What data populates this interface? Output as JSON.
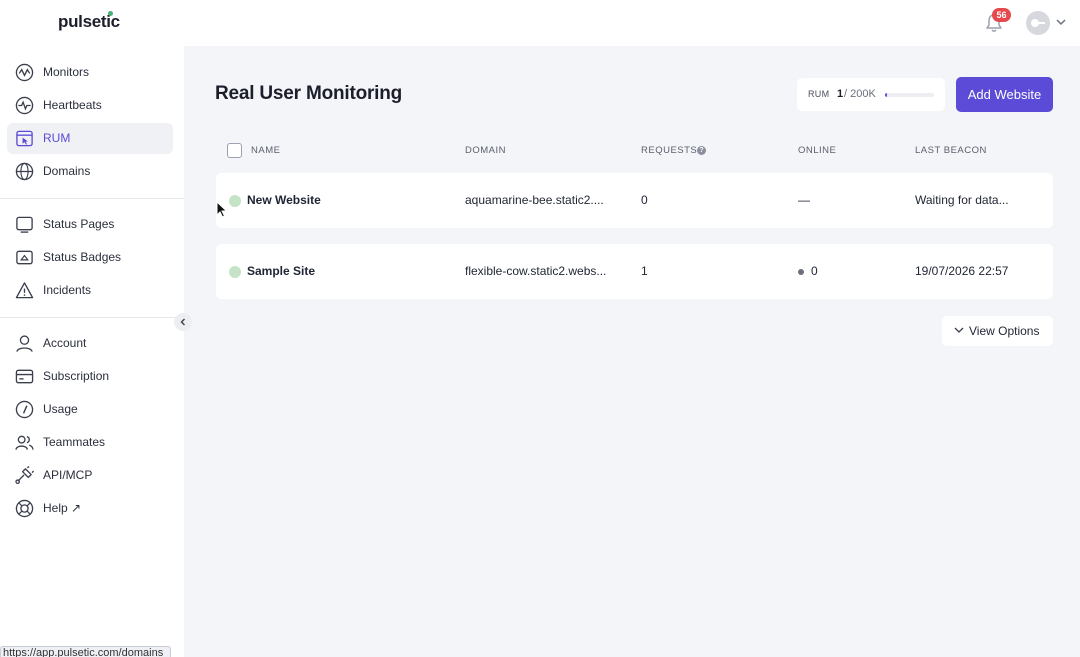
{
  "app": {
    "logo": "pulsetic"
  },
  "header": {
    "notifications_count": "56"
  },
  "sidebar": {
    "items": [
      {
        "label": "Monitors",
        "icon": "pulse-icon"
      },
      {
        "label": "Heartbeats",
        "icon": "heartbeat-icon"
      },
      {
        "label": "RUM",
        "icon": "rum-icon",
        "active": true
      },
      {
        "label": "Domains",
        "icon": "globe-icon"
      },
      {
        "label": "Status Pages",
        "icon": "monitor-icon"
      },
      {
        "label": "Status Badges",
        "icon": "badge-icon"
      },
      {
        "label": "Incidents",
        "icon": "warning-icon"
      },
      {
        "label": "Account",
        "icon": "user-icon"
      },
      {
        "label": "Subscription",
        "icon": "card-icon"
      },
      {
        "label": "Usage",
        "icon": "gauge-icon"
      },
      {
        "label": "Teammates",
        "icon": "team-icon"
      },
      {
        "label": "API/MCP",
        "icon": "plug-icon"
      },
      {
        "label": "Help ↗",
        "icon": "lifebuoy-icon"
      }
    ]
  },
  "statusbar": {
    "url": "https://app.pulsetic.com/domains"
  },
  "main": {
    "title": "Real User Monitoring",
    "usage": {
      "label": "RUM",
      "count": "1",
      "limit": "/ 200K",
      "fraction": 0.02
    },
    "add_button": "Add Website",
    "columns": {
      "name": "NAME",
      "domain": "DOMAIN",
      "requests": "REQUESTS",
      "online": "ONLINE",
      "last_beacon": "LAST BEACON"
    },
    "rows": [
      {
        "name": "New Website",
        "domain": "aquamarine-bee.static2....",
        "requests": "0",
        "online": "—",
        "last_beacon": "Waiting for data..."
      },
      {
        "name": "Sample Site",
        "domain": "flexible-cow.static2.webs...",
        "requests": "1",
        "online": "0",
        "last_beacon": "19/07/2026 22:57"
      }
    ],
    "view_options": "View Options"
  },
  "colors": {
    "accent": "#5b4bd6",
    "badge": "#e5484d",
    "status_dot": "#c5e3c6"
  }
}
